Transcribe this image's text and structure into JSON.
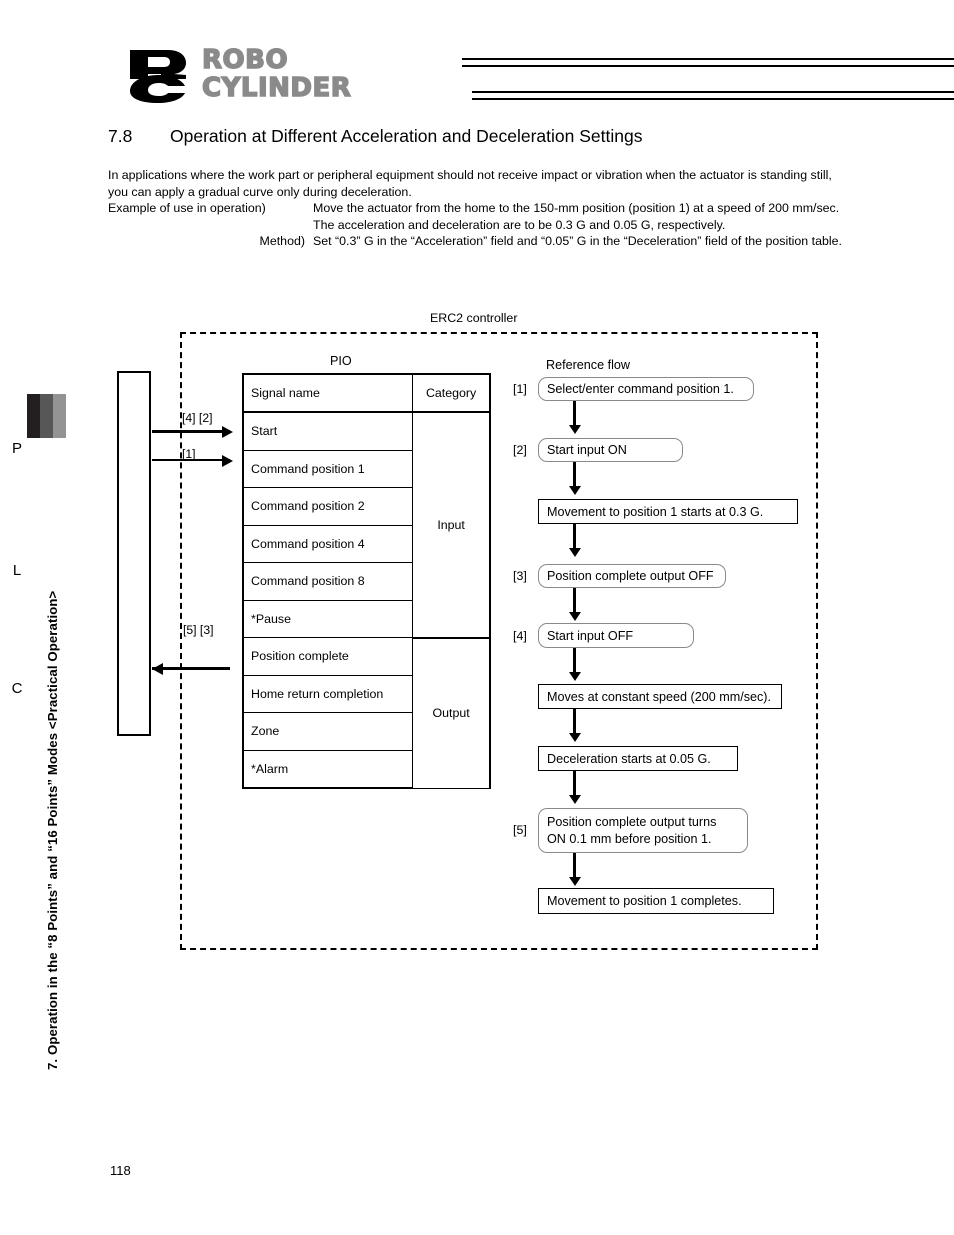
{
  "sidebar": {
    "caption": "7. Operation in the “8 Points” and “16 Points” Modes <Practical Operation>"
  },
  "logo": {
    "monogram": "RC",
    "word_top": "ROBO",
    "word_bottom": "CYLINDER"
  },
  "heading": {
    "number": "7.8",
    "title": "Operation at Different Acceleration and Deceleration Settings"
  },
  "intro": {
    "paragraph": "In applications where the work part or peripheral equipment should not receive impact or vibration when the actuator is standing still, you can apply a gradual curve only during deceleration."
  },
  "example": {
    "use_label": "Example of use in operation)",
    "use_text": "Move the actuator from the home to the 150-mm position (position 1) at a speed of 200 mm/sec. The acceleration and deceleration are to be 0.3 G and 0.05 G, respectively.",
    "method_label": "Method)",
    "method_text": "Set “0.3” G in the “Acceleration” field and “0.05” G in the “Deceleration” field of the position table."
  },
  "diagram": {
    "controller_label": "ERC2 controller",
    "plc": {
      "letters": [
        "P",
        "L",
        "C"
      ]
    },
    "signal_arrows": [
      {
        "label": "[4] [2]",
        "direction": "right"
      },
      {
        "label": "[1]",
        "direction": "right"
      },
      {
        "label": "[5] [3]",
        "direction": "left"
      }
    ],
    "pio": {
      "title": "PIO",
      "headers": [
        "Signal name",
        "Category"
      ],
      "rows": [
        {
          "signal": "Start",
          "category": ""
        },
        {
          "signal": "Command position 1",
          "category": ""
        },
        {
          "signal": "Command position 2",
          "category": "Input"
        },
        {
          "signal": "Command position 4",
          "category": ""
        },
        {
          "signal": "Command position 8",
          "category": ""
        },
        {
          "signal": "*Pause",
          "category": ""
        },
        {
          "signal": "Position complete",
          "category": ""
        },
        {
          "signal": "Home return completion",
          "category": "Output"
        },
        {
          "signal": "Zone",
          "category": ""
        },
        {
          "signal": "*Alarm",
          "category": ""
        }
      ]
    },
    "flow": {
      "title": "Reference flow",
      "steps": [
        {
          "marker": "[1]",
          "text": "Select/enter command position 1.",
          "shape": "rounded"
        },
        {
          "marker": "",
          "text": "Start input ON",
          "shape": "rounded",
          "marker_text": "[2]"
        },
        {
          "marker": "",
          "text": "Movement to position 1 starts at 0.3 G.",
          "shape": "rect"
        },
        {
          "marker": "[3]",
          "text": "Position complete output OFF",
          "shape": "rounded"
        },
        {
          "marker": "[4]",
          "text": "Start input OFF",
          "shape": "rounded"
        },
        {
          "marker": "",
          "text": "Moves at constant speed (200 mm/sec).",
          "shape": "rect"
        },
        {
          "marker": "",
          "text": "Deceleration starts at 0.05 G.",
          "shape": "rect"
        },
        {
          "marker": "[5]",
          "text_line1": "Position complete output turns",
          "text_line2": "ON 0.1 mm before position 1.",
          "shape": "rounded"
        },
        {
          "marker": "",
          "text": "Movement to position 1 completes.",
          "shape": "rect"
        }
      ]
    }
  },
  "footer": {
    "page_number": "118"
  },
  "colors": {
    "tab_dark": "#231f20",
    "tab_mid": "#575757",
    "tab_light": "#939393",
    "logo_gray": "#8a8a8a",
    "rounded_border": "#8a8a8a"
  }
}
